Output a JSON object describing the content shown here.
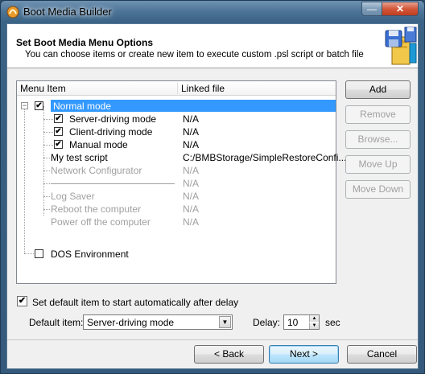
{
  "window": {
    "title": "Boot Media Builder",
    "minimize_glyph": "—",
    "close_glyph": "✕"
  },
  "header": {
    "title": "Set Boot Media Menu Options",
    "subtitle": "You can choose items or create new item to execute custom .psl script or batch file",
    "icon": "floppy-disk-and-computer-icon"
  },
  "list": {
    "columns": [
      "Menu Item",
      "Linked file"
    ],
    "rows": [
      {
        "label": "Normal mode",
        "link": "",
        "checked": true,
        "selected": true,
        "enabled": true
      },
      {
        "label": "Server-driving mode",
        "link": "N/A",
        "checked": true,
        "enabled": true
      },
      {
        "label": "Client-driving mode",
        "link": "N/A",
        "checked": true,
        "enabled": true
      },
      {
        "label": "Manual mode",
        "link": "N/A",
        "checked": true,
        "enabled": true
      },
      {
        "label": "My test script",
        "link": "C:/BMBStorage/SimpleRestoreConfi...",
        "enabled": true
      },
      {
        "label": "Network Configurator",
        "link": "N/A",
        "enabled": false
      },
      {
        "label": "",
        "link": "N/A",
        "enabled": false,
        "separator": true
      },
      {
        "label": "Log Saver",
        "link": "N/A",
        "enabled": false
      },
      {
        "label": "Reboot the computer",
        "link": "N/A",
        "enabled": false
      },
      {
        "label": "Power off the computer",
        "link": "N/A",
        "enabled": false
      },
      {
        "label": "DOS Environment",
        "link": "",
        "checked": false,
        "enabled": true
      }
    ],
    "check_glyph": "✔",
    "collapse_glyph": "−"
  },
  "side_buttons": {
    "add": "Add",
    "remove": "Remove",
    "browse": "Browse...",
    "move_up": "Move Up",
    "move_down": "Move Down"
  },
  "options": {
    "autostart_label": "Set default item to start automatically after delay",
    "autostart_checked": true,
    "default_item_label": "Default item:",
    "default_item_value": "Server-driving mode",
    "delay_label": "Delay:",
    "delay_value": "10",
    "delay_unit": "sec",
    "dropdown_glyph": "▼",
    "spin_up_glyph": "▲",
    "spin_down_glyph": "▼"
  },
  "footer": {
    "back": "< Back",
    "next": "Next >",
    "cancel": "Cancel"
  }
}
